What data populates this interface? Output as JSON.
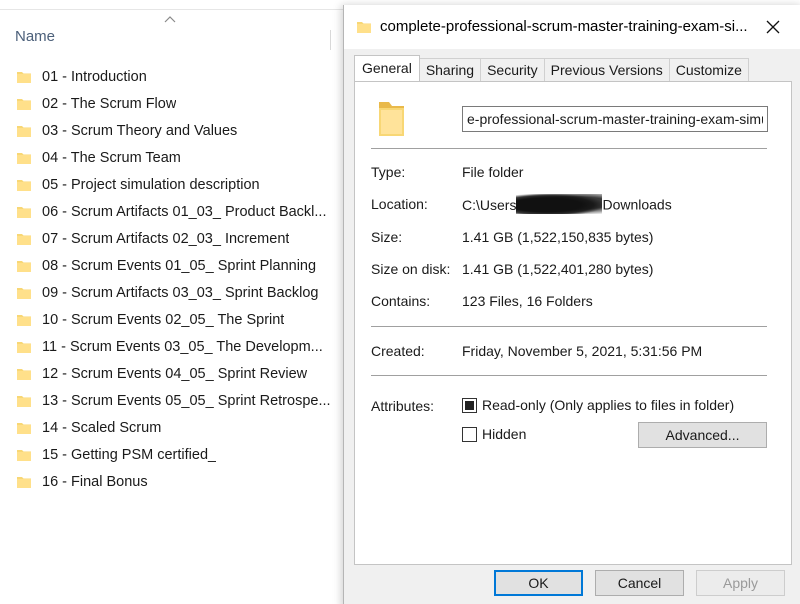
{
  "explorer": {
    "column_header": "Name",
    "items": [
      "01 - Introduction",
      "02 - The Scrum Flow",
      "03 - Scrum Theory and Values",
      "04 - The Scrum Team",
      "05 - Project simulation description",
      "06 - Scrum Artifacts 01_03_ Product Backl...",
      "07 - Scrum Artifacts 02_03_ Increment",
      "08 - Scrum Events 01_05_ Sprint Planning",
      "09 - Scrum Artifacts 03_03_ Sprint Backlog",
      "10 - Scrum Events 02_05_ The Sprint",
      "11 - Scrum Events 03_05_ The Developm...",
      "12 - Scrum Events 04_05_ Sprint Review",
      "13 - Scrum Events 05_05_ Sprint Retrospe...",
      "14 - Scaled Scrum",
      "15 - Getting PSM certified_",
      "16 - Final Bonus"
    ]
  },
  "dialog": {
    "title": "complete-professional-scrum-master-training-exam-si...",
    "tabs": [
      "General",
      "Sharing",
      "Security",
      "Previous Versions",
      "Customize"
    ],
    "name_field": "e-professional-scrum-master-training-exam-simulator",
    "type_label": "Type:",
    "type_value": "File folder",
    "location_label": "Location:",
    "location_prefix": "C:\\Users",
    "location_suffix": "Downloads",
    "size_label": "Size:",
    "size_value": "1.41 GB (1,522,150,835 bytes)",
    "size_on_disk_label": "Size on disk:",
    "size_on_disk_value": "1.41 GB (1,522,401,280 bytes)",
    "contains_label": "Contains:",
    "contains_value": "123 Files, 16 Folders",
    "created_label": "Created:",
    "created_value": "Friday, November 5, 2021, 5:31:56 PM",
    "attributes_label": "Attributes:",
    "readonly_label": "Read-only (Only applies to files in folder)",
    "hidden_label": "Hidden",
    "advanced_label": "Advanced...",
    "ok_label": "OK",
    "cancel_label": "Cancel",
    "apply_label": "Apply"
  },
  "colors": {
    "folder": "#f8d775",
    "accent": "#0078d7",
    "header_text": "#4c607a"
  },
  "icons": {
    "folder": "folder-icon",
    "close": "close-icon",
    "sort": "sort-ascending-icon"
  }
}
